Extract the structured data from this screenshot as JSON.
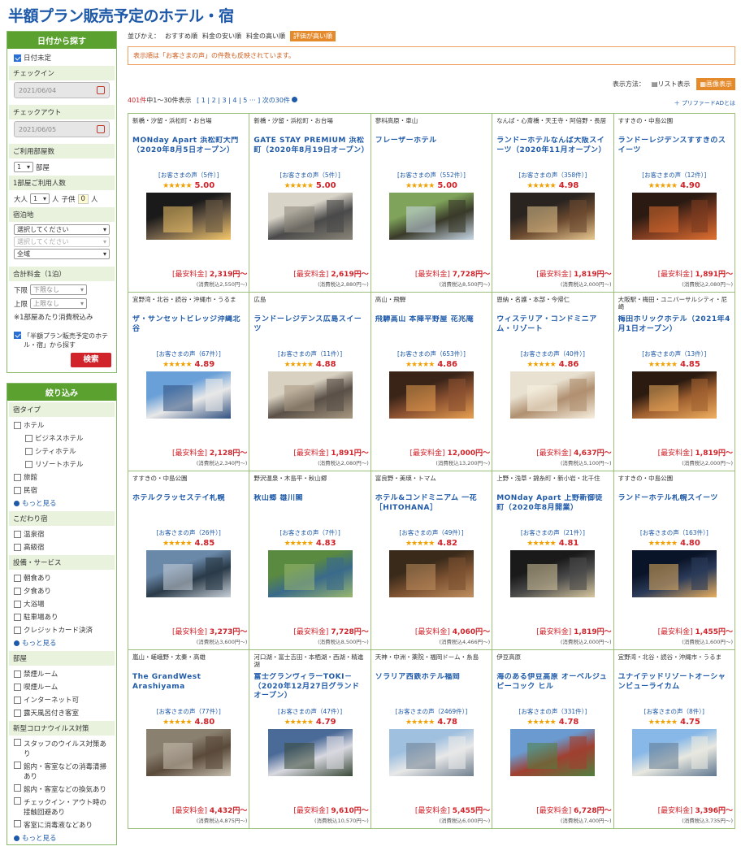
{
  "page_title": "半額プラン販売予定のホテル・宿",
  "sidebar": {
    "date_search": {
      "header": "日付から探す",
      "undecided_label": "日付未定",
      "checkin_label": "チェックイン",
      "checkin_value": "2021/06/04",
      "checkout_label": "チェックアウト",
      "checkout_value": "2021/06/05",
      "rooms_label": "ご利用部屋数",
      "rooms_value": "1",
      "rooms_unit": "部屋",
      "people_label": "1部屋ご利用人数",
      "adult_label": "大人",
      "adult_value": "1",
      "adult_unit": "人",
      "child_label": "子供",
      "child_value": "0",
      "child_unit": "人",
      "location_label": "宿泊地",
      "location_select1": "選択してください",
      "location_select2": "選択してください",
      "location_select3": "全域",
      "total_label": "合計料金（1泊）",
      "lower_label": "下限",
      "lower_value": "下限なし",
      "upper_label": "上限",
      "upper_value": "上限なし",
      "tax_note": "※1部屋あたり消費税込み",
      "plan_check_label": "「半額プラン販売予定のホテル・宿」から探す",
      "search_button": "検索"
    },
    "filter": {
      "header": "絞り込み",
      "type_label": "宿タイプ",
      "hotel": "ホテル",
      "business": "ビジネスホテル",
      "city": "シティホテル",
      "resort": "リゾートホテル",
      "ryokan": "旅館",
      "minshuku": "民宿",
      "more1": "もっと見る",
      "kodawari_label": "こだわり宿",
      "onsen": "温泉宿",
      "luxury": "高級宿",
      "facility_label": "設備・サービス",
      "breakfast": "朝食あり",
      "dinner": "夕食あり",
      "bath": "大浴場",
      "parking": "駐車場あり",
      "card": "クレジットカード決済",
      "more2": "もっと見る",
      "room_label": "部屋",
      "nonsmoking": "禁煙ルーム",
      "smoking": "喫煙ルーム",
      "internet": "インターネット可",
      "openair": "露天風呂付き客室",
      "corona_label": "新型コロナウイルス対策",
      "corona1": "スタッフのウイルス対策あり",
      "corona2": "館内・客室などの消毒清掃あり",
      "corona3": "館内・客室などの換気あり",
      "corona4": "チェックイン・アウト時の接触回避あり",
      "corona5": "客室に消毒液などあり",
      "more3": "もっと見る"
    }
  },
  "main": {
    "sort_label": "並びかえ：",
    "sort_options": [
      "おすすめ順",
      "料金の安い順",
      "料金の高い順",
      "評価が高い順"
    ],
    "notice": "表示順は「お客さまの声」の件数も反映されています。",
    "view_label": "表示方法：",
    "view_list": "リスト表示",
    "view_image": "画像表示",
    "count_total": "401件",
    "count_range": "中1〜30件表示",
    "pages": "[ 1 | 2 | 3 | 4 | 5 ··· ]",
    "next": "次の30件",
    "ad_label": "プリファードADとは",
    "min_price_label": "[最安料金]",
    "tax_prefix": "(消費税込",
    "tax_suffix": ")"
  },
  "hotels": [
    {
      "area": "新橋・汐留・浜松町・お台場",
      "name": "MONday Apart 浜松町大門（2020年8月5日オープン）",
      "reviews": "[お客さまの声（5件）]",
      "score": "5.00",
      "price": "2,319円〜",
      "tax": "2,550円〜",
      "stars": "★★★★★",
      "img": "a"
    },
    {
      "area": "新橋・汐留・浜松町・お台場",
      "name": "GATE STAY PREMIUM 浜松町（2020年8月19日オープン）",
      "reviews": "[お客さまの声（5件）]",
      "score": "5.00",
      "price": "2,619円〜",
      "tax": "2,880円〜",
      "stars": "★★★★★",
      "img": "b"
    },
    {
      "area": "蓼科高原・車山",
      "name": "フレーザーホテル",
      "reviews": "[お客さまの声（552件）]",
      "score": "5.00",
      "price": "7,728円〜",
      "tax": "8,500円〜",
      "stars": "★★★★★",
      "img": "c"
    },
    {
      "area": "なんば・心斎橋・天王寺・阿倍野・長居",
      "name": "ランドーホテルなんば大阪スイーツ（2020年11月オープン）",
      "reviews": "[お客さまの声（358件）]",
      "score": "4.98",
      "price": "1,819円〜",
      "tax": "2,000円〜",
      "stars": "★★★★★",
      "img": "d"
    },
    {
      "area": "すすきの・中島公園",
      "name": "ランドーレジデンスすすきのスイーツ",
      "reviews": "[お客さまの声（12件）]",
      "score": "4.90",
      "price": "1,891円〜",
      "tax": "2,080円〜",
      "stars": "★★★★★",
      "img": "e"
    },
    {
      "area": "宜野湾・北谷・読谷・沖縄市・うるま",
      "name": "ザ・サンセットビレッジ沖縄北谷",
      "reviews": "[お客さまの声（67件）]",
      "score": "4.89",
      "price": "2,128円〜",
      "tax": "2,340円〜",
      "stars": "★★★★★",
      "img": "f"
    },
    {
      "area": "広島",
      "name": "ランドーレジデンス広島スイーツ",
      "reviews": "[お客さまの声（11件）]",
      "score": "4.88",
      "price": "1,891円〜",
      "tax": "2,080円〜",
      "stars": "★★★★★",
      "img": "g"
    },
    {
      "area": "高山・飛騨",
      "name": "飛騨高山 本陣平野屋 花兆庵",
      "reviews": "[お客さまの声（653件）]",
      "score": "4.86",
      "price": "12,000円〜",
      "tax": "13,200円〜",
      "stars": "★★★★★",
      "img": "h"
    },
    {
      "area": "恩納・名護・本部・今帰仁",
      "name": "ウィステリア・コンドミニアム・リゾート",
      "reviews": "[お客さまの声（40件）]",
      "score": "4.86",
      "price": "4,637円〜",
      "tax": "5,100円〜",
      "stars": "★★★★★",
      "img": "i"
    },
    {
      "area": "大阪駅・梅田・ユニバーサルシティ・尼崎",
      "name": "梅田ホリックホテル（2021年4月1日オープン）",
      "reviews": "[お客さまの声（13件）]",
      "score": "4.85",
      "price": "1,819円〜",
      "tax": "2,000円〜",
      "stars": "★★★★★",
      "img": "j"
    },
    {
      "area": "すすきの・中島公園",
      "name": "ホテルクラッセステイ札幌",
      "reviews": "[お客さまの声（26件）]",
      "score": "4.85",
      "price": "3,273円〜",
      "tax": "3,600円〜",
      "stars": "★★★★★",
      "img": "k"
    },
    {
      "area": "野沢温泉・木島平・秋山郷",
      "name": "秋山郷 雄川閣",
      "reviews": "[お客さまの声（7件）]",
      "score": "4.83",
      "price": "7,728円〜",
      "tax": "8,500円〜",
      "stars": "★★★★★",
      "img": "l"
    },
    {
      "area": "富良野・美瑛・トマム",
      "name": "ホテル&コンドミニアム 一花［HITOHANA］",
      "reviews": "[お客さまの声（49件）]",
      "score": "4.82",
      "price": "4,060円〜",
      "tax": "4,466円〜",
      "stars": "★★★★★",
      "img": "m"
    },
    {
      "area": "上野・浅草・錦糸町・新小岩・北千住",
      "name": "MONday Apart 上野新御徒町（2020年8月開業）",
      "reviews": "[お客さまの声（21件）]",
      "score": "4.81",
      "price": "1,819円〜",
      "tax": "2,000円〜",
      "stars": "★★★★★",
      "img": "n"
    },
    {
      "area": "すすきの・中島公園",
      "name": "ランドーホテル札幌スイーツ",
      "reviews": "[お客さまの声（163件）]",
      "score": "4.80",
      "price": "1,455円〜",
      "tax": "1,600円〜",
      "stars": "★★★★★",
      "img": "o"
    },
    {
      "area": "嵐山・嵯峨野・太秦・高雄",
      "name": "The GrandWest Arashiyama",
      "reviews": "[お客さまの声（77件）]",
      "score": "4.80",
      "price": "4,432円〜",
      "tax": "4,875円〜",
      "stars": "★★★★★",
      "img": "p"
    },
    {
      "area": "河口湖・富士吉田・本栖湖・西湖・精進湖",
      "name": "富士グランヴィラーTOKI－（2020年12月27日グランドオープン）",
      "reviews": "[お客さまの声（47件）]",
      "score": "4.79",
      "price": "9,610円〜",
      "tax": "10,570円〜",
      "stars": "★★★★★",
      "img": "q"
    },
    {
      "area": "天神・中洲・薬院・福岡ドーム・糸島",
      "name": "ソラリア西鉄ホテル福岡",
      "reviews": "[お客さまの声（2469件）]",
      "score": "4.78",
      "price": "5,455円〜",
      "tax": "6,000円〜",
      "stars": "★★★★★",
      "img": "r"
    },
    {
      "area": "伊豆高原",
      "name": "海のある伊豆高原 オーベルジュ ピーコック ヒル",
      "reviews": "[お客さまの声（331件）]",
      "score": "4.78",
      "price": "6,728円〜",
      "tax": "7,400円〜",
      "stars": "★★★★★",
      "img": "s"
    },
    {
      "area": "宜野湾・北谷・読谷・沖縄市・うるま",
      "name": "ユナイテッドリゾートオーシャンビューライカム",
      "reviews": "[お客さまの声（8件）]",
      "score": "4.75",
      "price": "3,396円〜",
      "tax": "3,735円〜",
      "stars": "★★★★★",
      "img": "t"
    }
  ],
  "colors": {
    "accent": "#5aa12f",
    "link": "#1f5aa8",
    "price": "#d0232a",
    "sort_active": "#e58a2b"
  }
}
